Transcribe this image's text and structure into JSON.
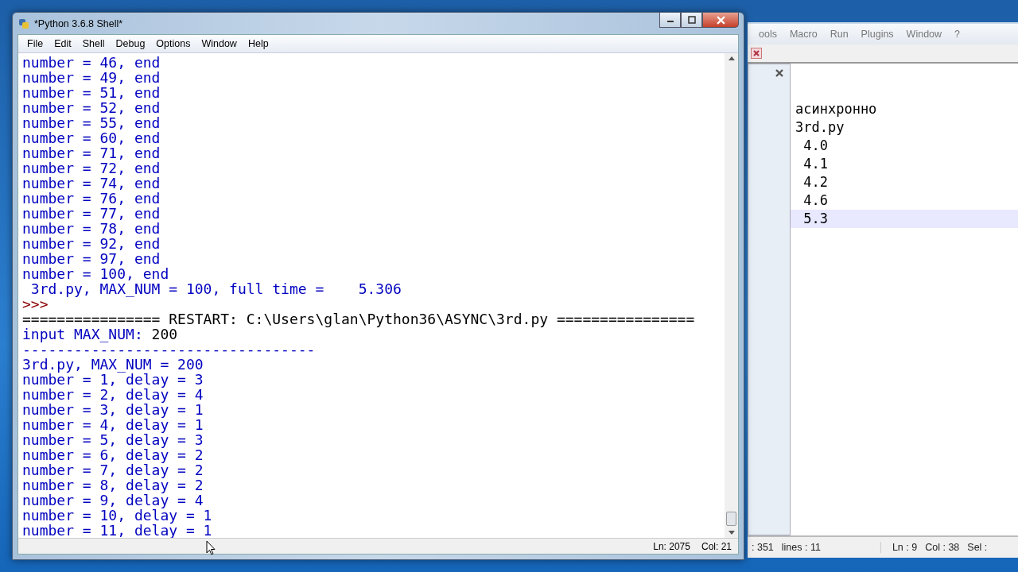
{
  "shell_window": {
    "title": "*Python 3.6.8 Shell*",
    "menu": [
      "File",
      "Edit",
      "Shell",
      "Debug",
      "Options",
      "Window",
      "Help"
    ],
    "lines": [
      {
        "kind": "stdout",
        "text": "number = 46, end"
      },
      {
        "kind": "stdout",
        "text": "number = 49, end"
      },
      {
        "kind": "stdout",
        "text": "number = 51, end"
      },
      {
        "kind": "stdout",
        "text": "number = 52, end"
      },
      {
        "kind": "stdout",
        "text": "number = 55, end"
      },
      {
        "kind": "stdout",
        "text": "number = 60, end"
      },
      {
        "kind": "stdout",
        "text": "number = 71, end"
      },
      {
        "kind": "stdout",
        "text": "number = 72, end"
      },
      {
        "kind": "stdout",
        "text": "number = 74, end"
      },
      {
        "kind": "stdout",
        "text": "number = 76, end"
      },
      {
        "kind": "stdout",
        "text": "number = 77, end"
      },
      {
        "kind": "stdout",
        "text": "number = 78, end"
      },
      {
        "kind": "stdout",
        "text": "number = 92, end"
      },
      {
        "kind": "stdout",
        "text": "number = 97, end"
      },
      {
        "kind": "stdout",
        "text": "number = 100, end"
      },
      {
        "kind": "stdout",
        "text": " 3rd.py, MAX_NUM = 100, full time =    5.306"
      },
      {
        "kind": "prompt",
        "text": ">>>"
      },
      {
        "kind": "restart",
        "text": "================ RESTART: C:\\Users\\glan\\Python36\\ASYNC\\3rd.py ================"
      },
      {
        "kind": "input",
        "text": "input MAX_NUM: ",
        "value": "200"
      },
      {
        "kind": "stdout",
        "text": "----------------------------------"
      },
      {
        "kind": "stdout",
        "text": "3rd.py, MAX_NUM = 200"
      },
      {
        "kind": "stdout",
        "text": "number = 1, delay = 3"
      },
      {
        "kind": "stdout",
        "text": "number = 2, delay = 4"
      },
      {
        "kind": "stdout",
        "text": "number = 3, delay = 1"
      },
      {
        "kind": "stdout",
        "text": "number = 4, delay = 1"
      },
      {
        "kind": "stdout",
        "text": "number = 5, delay = 3"
      },
      {
        "kind": "stdout",
        "text": "number = 6, delay = 2"
      },
      {
        "kind": "stdout",
        "text": "number = 7, delay = 2"
      },
      {
        "kind": "stdout",
        "text": "number = 8, delay = 2"
      },
      {
        "kind": "stdout",
        "text": "number = 9, delay = 4"
      },
      {
        "kind": "stdout",
        "text": "number = 10, delay = 1"
      },
      {
        "kind": "stdout",
        "text": "number = 11, delay = 1"
      }
    ],
    "status": [
      "Ln: 2075",
      "Col: 21"
    ]
  },
  "editor_window": {
    "menu": [
      "ools",
      "Macro",
      "Run",
      "Plugins",
      "Window",
      "?"
    ],
    "lines": [
      {
        "text": "асинхронно",
        "selected": false
      },
      {
        "text": "3rd.py",
        "selected": false
      },
      {
        "text": " 4.0",
        "selected": false
      },
      {
        "text": " 4.1",
        "selected": false
      },
      {
        "text": " 4.2",
        "selected": false
      },
      {
        "text": " 4.6",
        "selected": false
      },
      {
        "text": " 5.3",
        "selected": true
      }
    ],
    "status": [
      ": 351",
      "lines : 11",
      "Ln : 9",
      "Col : 38",
      "Sel :"
    ]
  }
}
